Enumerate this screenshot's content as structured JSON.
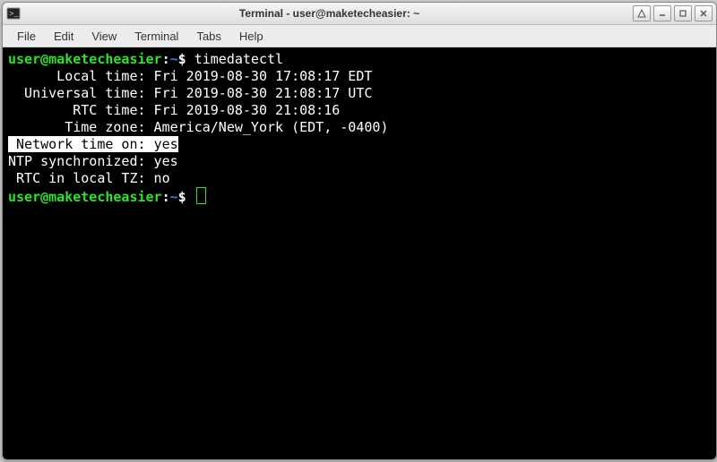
{
  "window": {
    "title": "Terminal - user@maketecheasier: ~"
  },
  "menu": {
    "file": "File",
    "edit": "Edit",
    "view": "View",
    "terminal": "Terminal",
    "tabs": "Tabs",
    "help": "Help"
  },
  "prompt": {
    "userhost": "user@maketecheasier",
    "sep": ":",
    "path": "~",
    "sym": "$"
  },
  "command": "timedatectl",
  "output": {
    "local_line": "      Local time: Fri 2019-08-30 17:08:17 EDT",
    "universal_line": "  Universal time: Fri 2019-08-30 21:08:17 UTC",
    "rtc_line": "        RTC time: Fri 2019-08-30 21:08:16",
    "tz_line": "       Time zone: America/New_York (EDT, -0400)",
    "net_label": " Network time on: ",
    "net_value": "yes",
    "ntp_line": "NTP synchronized: yes",
    "rtc_local_line": " RTC in local TZ: no"
  }
}
